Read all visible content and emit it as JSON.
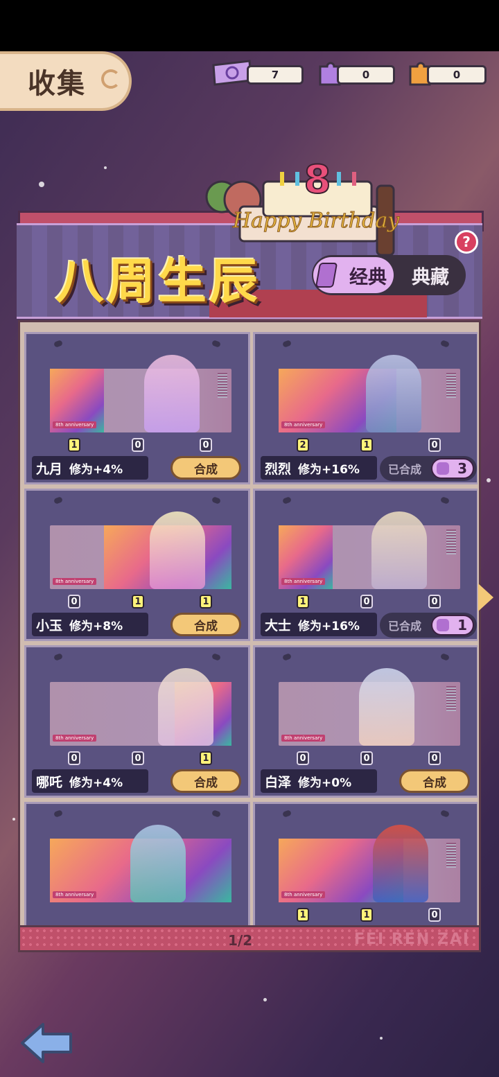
{
  "header": {
    "title": "收集"
  },
  "currencies": [
    {
      "icon": "ticket-icon",
      "value": "7",
      "color": "#c8a0e8"
    },
    {
      "icon": "purple-puzzle-icon",
      "value": "0",
      "color": "#b080e0"
    },
    {
      "icon": "orange-puzzle-icon",
      "value": "0",
      "color": "#f0a040"
    }
  ],
  "banner": {
    "title": "八周生辰",
    "tab_active": "经典",
    "tab_inactive": "典藏",
    "help": "?",
    "cake_text": "Happy Birthday",
    "cake_number": "8"
  },
  "cards": [
    {
      "name": "九月",
      "bonus": "修为+4%",
      "counts": [
        "1",
        "0",
        "0"
      ],
      "status": "button",
      "button": "合成"
    },
    {
      "name": "烈烈",
      "bonus": "修为+16%",
      "counts": [
        "2",
        "1",
        "0"
      ],
      "status": "done",
      "done_label": "已合成",
      "done_count": "3"
    },
    {
      "name": "小玉",
      "bonus": "修为+8%",
      "counts": [
        "0",
        "1",
        "1"
      ],
      "status": "button",
      "button": "合成"
    },
    {
      "name": "大士",
      "bonus": "修为+16%",
      "counts": [
        "1",
        "0",
        "0"
      ],
      "status": "done",
      "done_label": "已合成",
      "done_count": "1"
    },
    {
      "name": "哪吒",
      "bonus": "修为+4%",
      "counts": [
        "0",
        "0",
        "1"
      ],
      "status": "button",
      "button": "合成"
    },
    {
      "name": "白泽",
      "bonus": "修为+0%",
      "counts": [
        "0",
        "0",
        "0"
      ],
      "status": "button",
      "button": "合成"
    },
    {
      "name": "",
      "bonus": "",
      "counts": [],
      "status": "partial"
    },
    {
      "name": "",
      "bonus": "",
      "counts": [
        "1",
        "1",
        "0"
      ],
      "status": "partial"
    }
  ],
  "anniversary_label": "8th anniversary",
  "pager": "1/2",
  "brand": "FEI REN ZAI",
  "nav": {
    "back": "back-arrow-icon",
    "next": "next-page-icon"
  }
}
